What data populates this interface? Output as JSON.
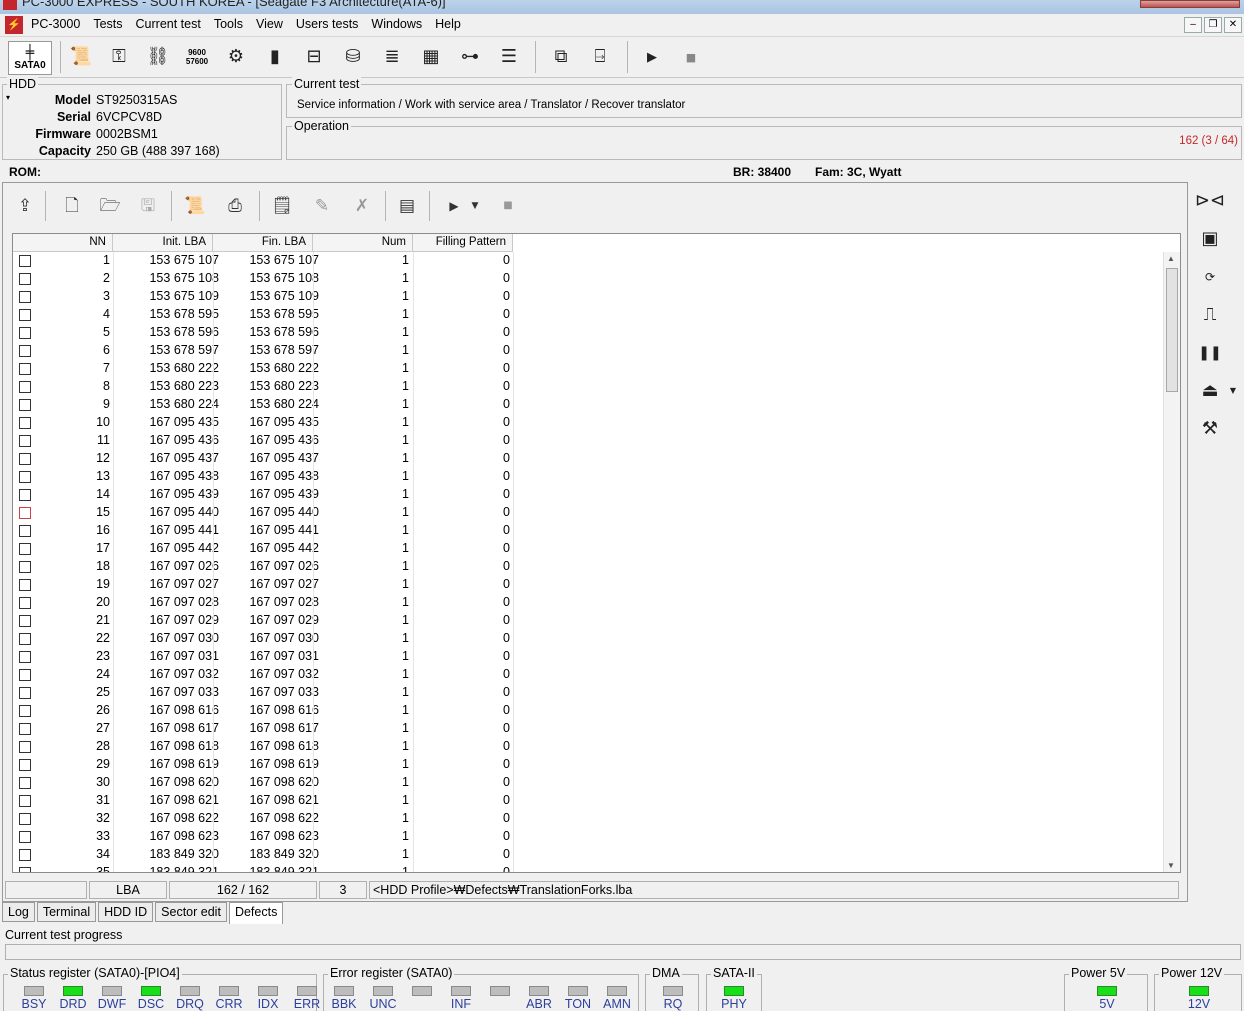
{
  "window": {
    "title": "PC-3000 EXPRESS - SOUTH KOREA - [Seagate F3 Architecture(ATA-6)]"
  },
  "menu": {
    "app_label": "PC-3000",
    "items": [
      "Tests",
      "Current test",
      "Tools",
      "View",
      "Users tests",
      "Windows",
      "Help"
    ]
  },
  "toolbar": {
    "port_label": "SATA0",
    "icons": [
      "sata-port-icon",
      "scroll-icon",
      "key-icon",
      "network-icon",
      "baud-rate-icon",
      "gear-icon",
      "chip-icon",
      "drive-icon",
      "disk-icon",
      "stack-icon",
      "grid-icon",
      "tree-icon",
      "list-icon",
      "copy-icon",
      "exit-icon",
      "play-icon",
      "stop-icon"
    ],
    "baud_top": "9600",
    "baud_bottom": "57600"
  },
  "hdd": {
    "group_label": "HDD",
    "model_label": "Model",
    "model": "ST9250315AS",
    "serial_label": "Serial",
    "serial": "6VCPCV8D",
    "firmware_label": "Firmware",
    "firmware": "0002BSM1",
    "capacity_label": "Capacity",
    "capacity": "250 GB (488 397 168)"
  },
  "current_test": {
    "label": "Current test",
    "value": "Service information / Work with service area / Translator / Recover translator"
  },
  "operation": {
    "label": "Operation",
    "counter": "162 (3 / 64)"
  },
  "rom_line": {
    "rom_label": "ROM:",
    "br": "BR: 38400",
    "fam": "Fam: 3C, Wyatt"
  },
  "table": {
    "columns": [
      "NN",
      "Init. LBA",
      "Fin. LBA",
      "Num",
      "Filling Pattern"
    ],
    "rows": [
      {
        "nn": "1",
        "init": "153 675 107",
        "fin": "153 675 107",
        "num": "1",
        "fill": "0"
      },
      {
        "nn": "2",
        "init": "153 675 108",
        "fin": "153 675 108",
        "num": "1",
        "fill": "0"
      },
      {
        "nn": "3",
        "init": "153 675 109",
        "fin": "153 675 109",
        "num": "1",
        "fill": "0"
      },
      {
        "nn": "4",
        "init": "153 678 595",
        "fin": "153 678 595",
        "num": "1",
        "fill": "0"
      },
      {
        "nn": "5",
        "init": "153 678 596",
        "fin": "153 678 596",
        "num": "1",
        "fill": "0"
      },
      {
        "nn": "6",
        "init": "153 678 597",
        "fin": "153 678 597",
        "num": "1",
        "fill": "0"
      },
      {
        "nn": "7",
        "init": "153 680 222",
        "fin": "153 680 222",
        "num": "1",
        "fill": "0"
      },
      {
        "nn": "8",
        "init": "153 680 223",
        "fin": "153 680 223",
        "num": "1",
        "fill": "0"
      },
      {
        "nn": "9",
        "init": "153 680 224",
        "fin": "153 680 224",
        "num": "1",
        "fill": "0"
      },
      {
        "nn": "10",
        "init": "167 095 435",
        "fin": "167 095 435",
        "num": "1",
        "fill": "0"
      },
      {
        "nn": "11",
        "init": "167 095 436",
        "fin": "167 095 436",
        "num": "1",
        "fill": "0"
      },
      {
        "nn": "12",
        "init": "167 095 437",
        "fin": "167 095 437",
        "num": "1",
        "fill": "0"
      },
      {
        "nn": "13",
        "init": "167 095 438",
        "fin": "167 095 438",
        "num": "1",
        "fill": "0"
      },
      {
        "nn": "14",
        "init": "167 095 439",
        "fin": "167 095 439",
        "num": "1",
        "fill": "0"
      },
      {
        "nn": "15",
        "init": "167 095 440",
        "fin": "167 095 440",
        "num": "1",
        "fill": "0"
      },
      {
        "nn": "16",
        "init": "167 095 441",
        "fin": "167 095 441",
        "num": "1",
        "fill": "0"
      },
      {
        "nn": "17",
        "init": "167 095 442",
        "fin": "167 095 442",
        "num": "1",
        "fill": "0"
      },
      {
        "nn": "18",
        "init": "167 097 026",
        "fin": "167 097 026",
        "num": "1",
        "fill": "0"
      },
      {
        "nn": "19",
        "init": "167 097 027",
        "fin": "167 097 027",
        "num": "1",
        "fill": "0"
      },
      {
        "nn": "20",
        "init": "167 097 028",
        "fin": "167 097 028",
        "num": "1",
        "fill": "0"
      },
      {
        "nn": "21",
        "init": "167 097 029",
        "fin": "167 097 029",
        "num": "1",
        "fill": "0"
      },
      {
        "nn": "22",
        "init": "167 097 030",
        "fin": "167 097 030",
        "num": "1",
        "fill": "0"
      },
      {
        "nn": "23",
        "init": "167 097 031",
        "fin": "167 097 031",
        "num": "1",
        "fill": "0"
      },
      {
        "nn": "24",
        "init": "167 097 032",
        "fin": "167 097 032",
        "num": "1",
        "fill": "0"
      },
      {
        "nn": "25",
        "init": "167 097 033",
        "fin": "167 097 033",
        "num": "1",
        "fill": "0"
      },
      {
        "nn": "26",
        "init": "167 098 616",
        "fin": "167 098 616",
        "num": "1",
        "fill": "0"
      },
      {
        "nn": "27",
        "init": "167 098 617",
        "fin": "167 098 617",
        "num": "1",
        "fill": "0"
      },
      {
        "nn": "28",
        "init": "167 098 618",
        "fin": "167 098 618",
        "num": "1",
        "fill": "0"
      },
      {
        "nn": "29",
        "init": "167 098 619",
        "fin": "167 098 619",
        "num": "1",
        "fill": "0"
      },
      {
        "nn": "30",
        "init": "167 098 620",
        "fin": "167 098 620",
        "num": "1",
        "fill": "0"
      },
      {
        "nn": "31",
        "init": "167 098 621",
        "fin": "167 098 621",
        "num": "1",
        "fill": "0"
      },
      {
        "nn": "32",
        "init": "167 098 622",
        "fin": "167 098 622",
        "num": "1",
        "fill": "0"
      },
      {
        "nn": "33",
        "init": "167 098 623",
        "fin": "167 098 623",
        "num": "1",
        "fill": "0"
      },
      {
        "nn": "34",
        "init": "183 849 320",
        "fin": "183 849 320",
        "num": "1",
        "fill": "0"
      },
      {
        "nn": "35",
        "init": "183 849 321",
        "fin": "183 849 321",
        "num": "1",
        "fill": "0"
      }
    ],
    "highlighted_checkbox_row": 15
  },
  "status_row": {
    "mode": "LBA",
    "position": "162 / 162",
    "num": "3",
    "path": "<HDD Profile>₩Defects₩TranslationForks.lba"
  },
  "tabs": [
    "Log",
    "Terminal",
    "HDD ID",
    "Sector edit",
    "Defects"
  ],
  "active_tab": "Defects",
  "progress": {
    "label": "Current test progress"
  },
  "registers": {
    "status": {
      "title": "Status register (SATA0)-[PIO4]",
      "leds": [
        {
          "label": "BSY",
          "on": false
        },
        {
          "label": "DRD",
          "on": true
        },
        {
          "label": "DWF",
          "on": false
        },
        {
          "label": "DSC",
          "on": true
        },
        {
          "label": "DRQ",
          "on": false
        },
        {
          "label": "CRR",
          "on": false
        },
        {
          "label": "IDX",
          "on": false
        },
        {
          "label": "ERR",
          "on": false
        }
      ]
    },
    "error": {
      "title": "Error register (SATA0)",
      "leds": [
        {
          "label": "BBK",
          "on": false
        },
        {
          "label": "UNC",
          "on": false
        },
        {
          "label": "",
          "on": false
        },
        {
          "label": "INF",
          "on": false
        },
        {
          "label": "",
          "on": false
        },
        {
          "label": "ABR",
          "on": false
        },
        {
          "label": "TON",
          "on": false
        },
        {
          "label": "AMN",
          "on": false
        }
      ]
    },
    "dma": {
      "title": "DMA",
      "leds": [
        {
          "label": "RQ",
          "on": false
        }
      ]
    },
    "sata": {
      "title": "SATA-II",
      "leds": [
        {
          "label": "PHY",
          "on": true
        }
      ]
    },
    "power5": {
      "title": "Power 5V",
      "leds": [
        {
          "label": "5V",
          "on": true
        }
      ]
    },
    "power12": {
      "title": "Power 12V",
      "leds": [
        {
          "label": "12V",
          "on": true
        }
      ]
    }
  },
  "colors": {
    "counter": "#c62828",
    "led_on": "#18e018",
    "led_off": "#bdbdbd",
    "led_label": "#2c3f9c"
  }
}
